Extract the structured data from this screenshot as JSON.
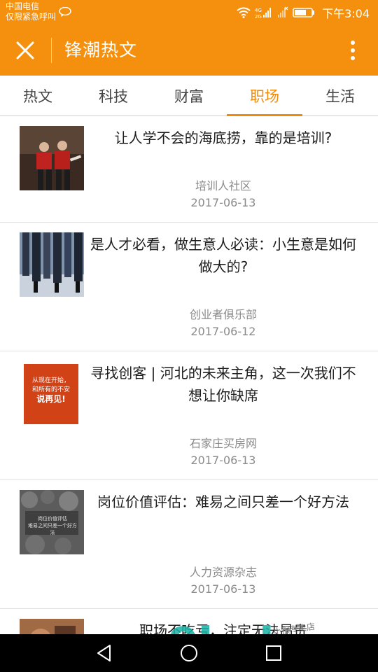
{
  "status_bar": {
    "carrier": "中国电信",
    "emergency": "仅限紧急呼叫",
    "network": "4G 2G",
    "time": "下午3:04"
  },
  "header": {
    "close_icon": "close-icon",
    "title": "锋潮热文",
    "more_icon": "more-vertical-icon"
  },
  "tabs": [
    {
      "label": "热文"
    },
    {
      "label": "科技"
    },
    {
      "label": "财富"
    },
    {
      "label": "职场",
      "active": true
    },
    {
      "label": "生活"
    }
  ],
  "articles": [
    {
      "title": "让人学不会的海底捞，靠的是培训?",
      "source": "培训人社区",
      "date": "2017-06-13"
    },
    {
      "title": "是人才必看，做生意人必读：小生意是如何做大的?",
      "source": "创业者俱乐部",
      "date": "2017-06-12"
    },
    {
      "title": "寻找创客 | 河北的未来主角，这一次我们不想让你缺席",
      "source": "石家庄买房网",
      "date": "2017-06-13",
      "thumb_text": [
        "从现在开始，",
        "和所有的不安",
        "说再见!"
      ]
    },
    {
      "title": "岗位价值评估：难易之间只差一个好方法",
      "source": "人力资源杂志",
      "date": "2017-06-13",
      "thumb_text": [
        "岗位价值评估",
        "难易之间只差一个好方法"
      ]
    },
    {
      "title": "职场不吃亏，注定无法昂贵"
    }
  ],
  "nav": {
    "back_icon": "back-triangle-icon",
    "home_icon": "home-circle-icon",
    "recents_icon": "recents-square-icon"
  },
  "watermark": {
    "big": "9lud",
    "com": ".com",
    "small": "小猴专卖店"
  },
  "colors": {
    "brand_orange": "#f5900f",
    "active_tab": "#f08a0a",
    "meta_gray": "#8a8a8a"
  }
}
